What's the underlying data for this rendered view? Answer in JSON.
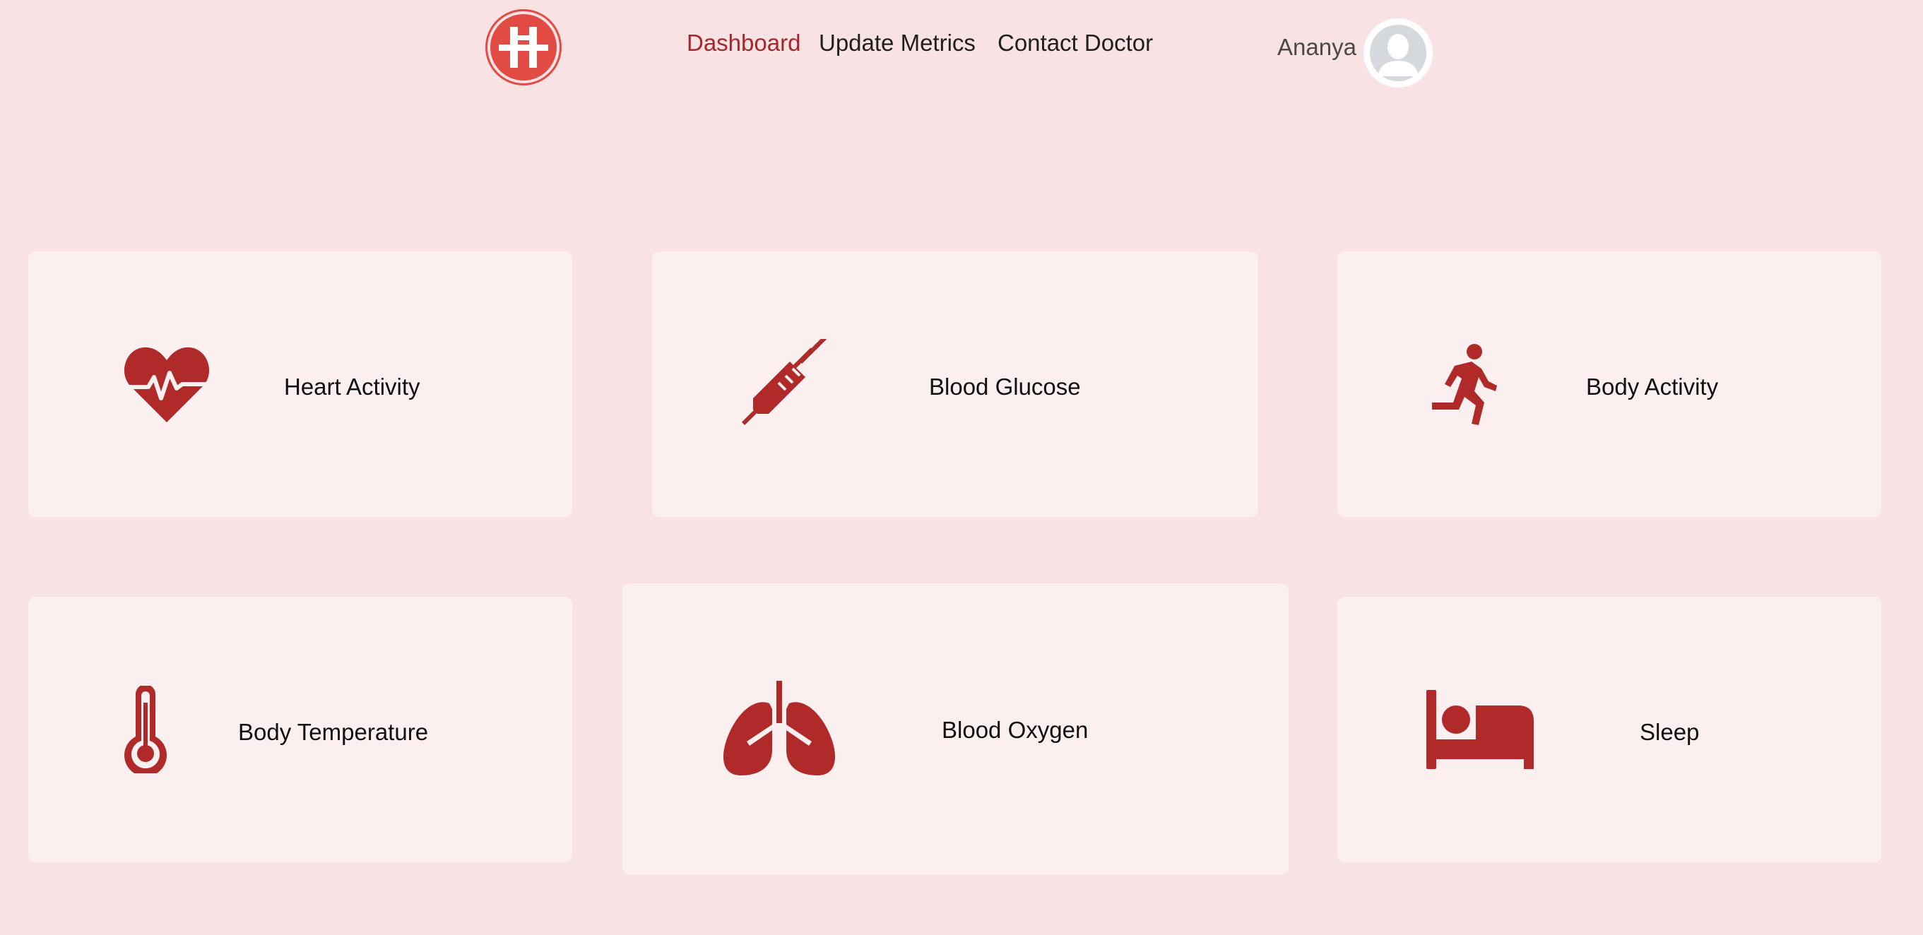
{
  "header": {
    "logo_letter": "H",
    "nav": [
      {
        "label": "Dashboard",
        "active": true
      },
      {
        "label": "Update Metrics",
        "active": false
      },
      {
        "label": "Contact Doctor",
        "active": false
      }
    ],
    "user_name": "Ananya"
  },
  "cards": [
    {
      "label": "Heart Activity",
      "icon": "heart-pulse-icon"
    },
    {
      "label": "Blood Glucose",
      "icon": "syringe-icon"
    },
    {
      "label": "Body Activity",
      "icon": "running-person-icon"
    },
    {
      "label": "Body Temperature",
      "icon": "thermometer-icon"
    },
    {
      "label": "Blood Oxygen",
      "icon": "lungs-icon"
    },
    {
      "label": "Sleep",
      "icon": "bed-icon"
    }
  ],
  "colors": {
    "background": "#f8e2e3",
    "card": "#fbeff0",
    "accent": "#a6262a",
    "icon": "#b02a2a",
    "logo": "#e24b43"
  }
}
